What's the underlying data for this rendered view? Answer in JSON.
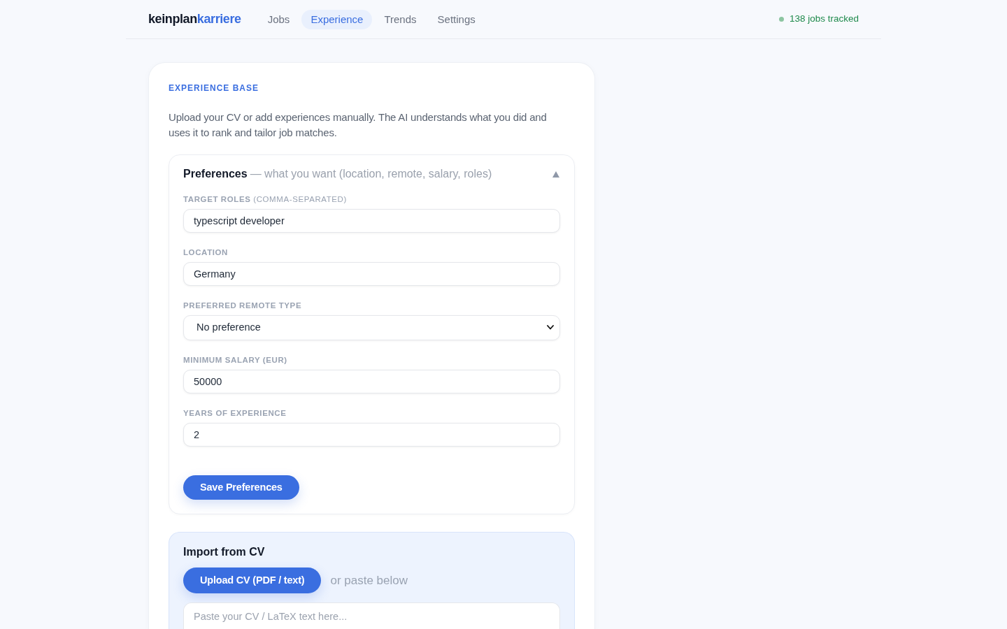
{
  "navbar": {
    "brand": {
      "part_1": "keinplan",
      "part_2": "karriere"
    },
    "links": [
      {
        "label": "Jobs",
        "selected": false
      },
      {
        "label": "Experience",
        "selected": true
      },
      {
        "label": "Trends",
        "selected": false
      },
      {
        "label": "Settings",
        "selected": false
      }
    ],
    "status": {
      "text": "138 jobs tracked",
      "color": "#8cc5a1"
    }
  },
  "experience_base": {
    "eyebrow": "EXPERIENCE BASE",
    "intro": "Upload your CV or add experiences manually. The AI understands what you did and uses it to rank and tailor job matches.",
    "preferences": {
      "title": "Preferences",
      "subtitle": "— what you want (location, remote, salary, roles)",
      "expanded": true,
      "fields": [
        {
          "kind": "text",
          "label": "TARGET ROLES",
          "label_note": "(COMMA-SEPARATED)",
          "value": "typescript developer"
        },
        {
          "kind": "text",
          "label": "LOCATION",
          "value": "Germany"
        },
        {
          "kind": "select",
          "label": "PREFERRED REMOTE TYPE",
          "value": "No preference"
        },
        {
          "kind": "number",
          "label": "MINIMUM SALARY (EUR)",
          "value": "50000"
        },
        {
          "kind": "number",
          "label": "YEARS OF EXPERIENCE",
          "value": "2"
        }
      ],
      "save_button": "Save Preferences"
    },
    "import_cv": {
      "title": "Import from CV",
      "upload_button": "Upload CV (PDF / text)",
      "hint": "or paste below",
      "cv_text": {
        "placeholder": "Paste your CV / LaTeX text here..."
      }
    }
  }
}
